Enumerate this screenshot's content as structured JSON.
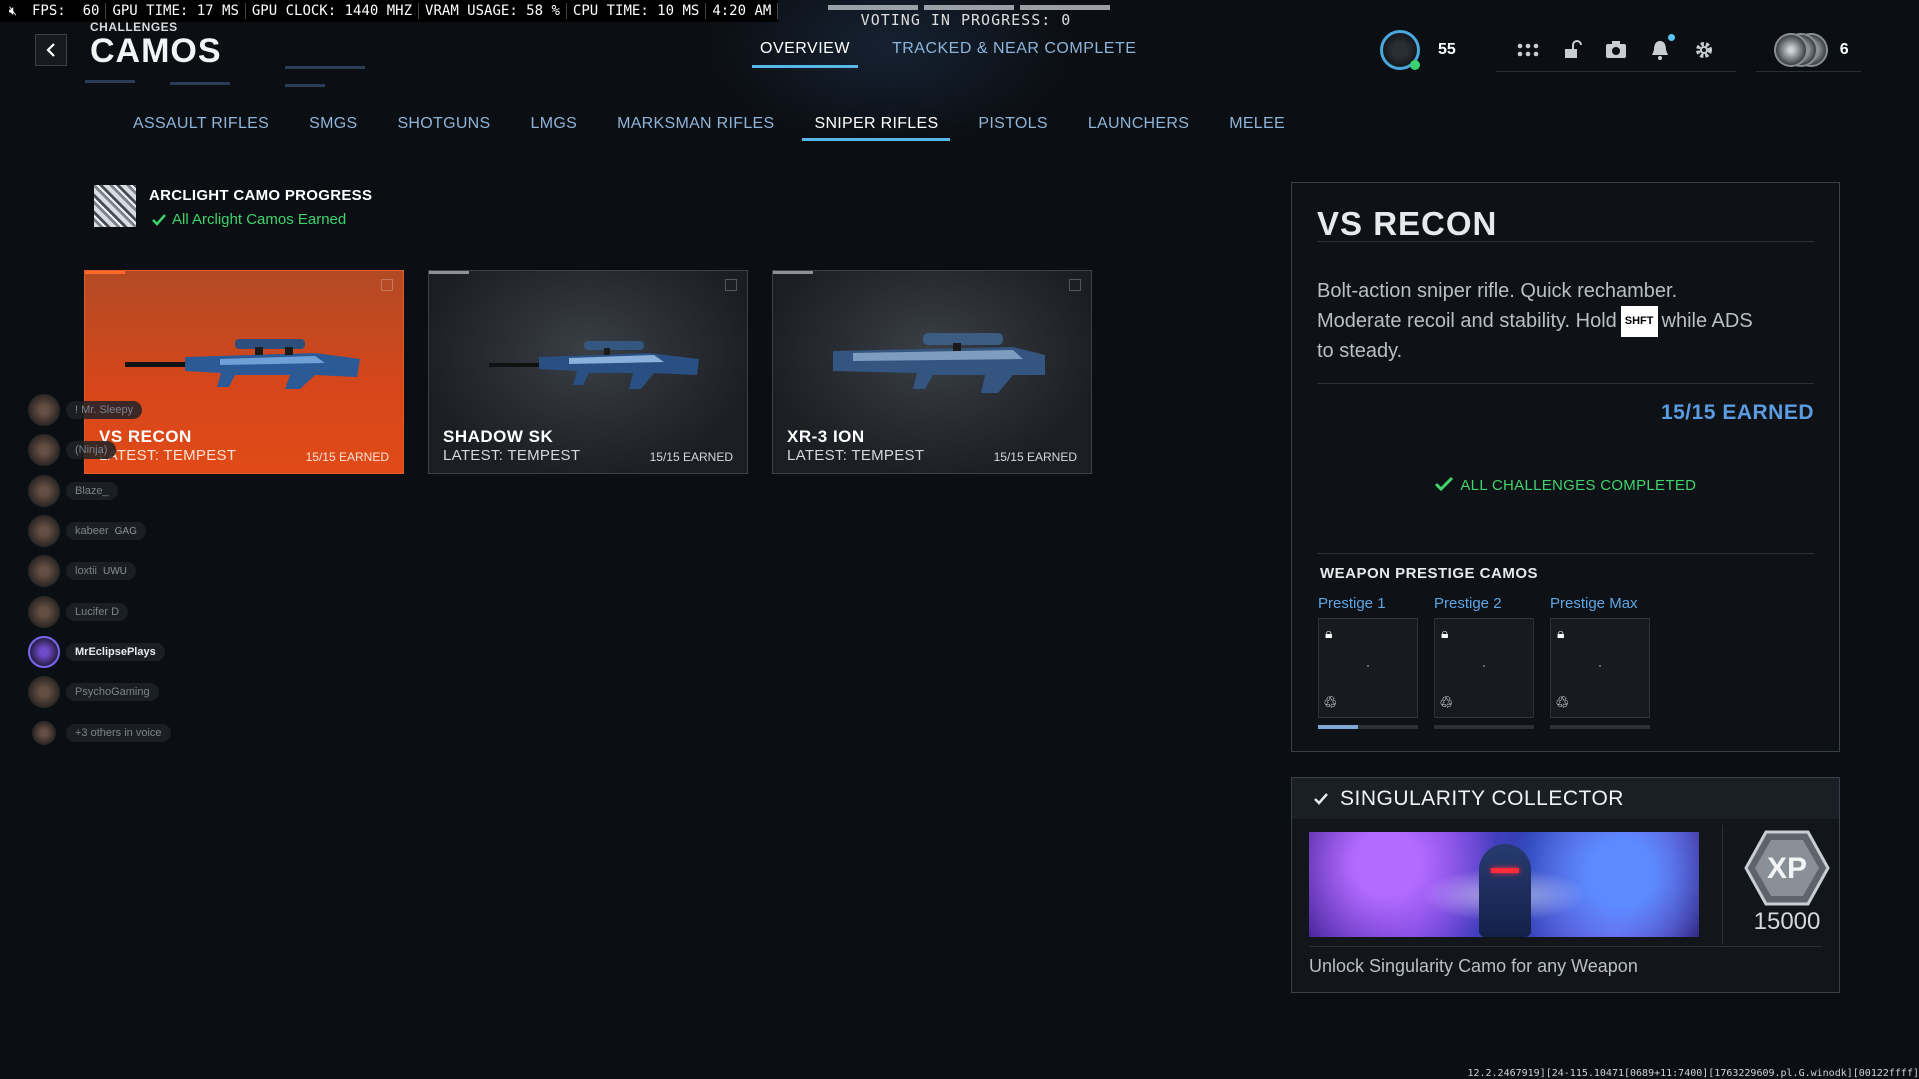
{
  "perf": {
    "mute_icon": "speaker-muted-icon",
    "fps": "FPS:  60",
    "gpu_time": "GPU TIME: 17 MS",
    "gpu_clock": "GPU CLOCK: 1440 MHZ",
    "vram": "VRAM USAGE: 58 %",
    "cpu_time": "CPU TIME: 10 MS",
    "clock": "4:20 AM"
  },
  "voting": {
    "text": "VOTING IN PROGRESS: 0"
  },
  "header": {
    "breadcrumb": "CHALLENGES",
    "title": "CAMOS",
    "tabs": [
      {
        "label": "OVERVIEW",
        "active": true
      },
      {
        "label": "TRACKED & NEAR COMPLETE",
        "active": false
      }
    ],
    "rank": "55",
    "squad_count": "6",
    "icons": [
      "apps-grid-icon",
      "unlock-icon",
      "camera-icon",
      "bell-icon",
      "gear-icon"
    ]
  },
  "categories": [
    {
      "label": "ASSAULT RIFLES"
    },
    {
      "label": "SMGS"
    },
    {
      "label": "SHOTGUNS"
    },
    {
      "label": "LMGS"
    },
    {
      "label": "MARKSMAN RIFLES"
    },
    {
      "label": "SNIPER RIFLES",
      "active": true
    },
    {
      "label": "PISTOLS"
    },
    {
      "label": "LAUNCHERS"
    },
    {
      "label": "MELEE"
    }
  ],
  "arclight": {
    "title": "ARCLIGHT CAMO PROGRESS",
    "status": "All Arclight Camos Earned"
  },
  "weapons": [
    {
      "name": "VS RECON",
      "latest": "LATEST: TEMPEST",
      "earned": "15/15 EARNED",
      "selected": true
    },
    {
      "name": "SHADOW SK",
      "latest": "LATEST: TEMPEST",
      "earned": "15/15 EARNED"
    },
    {
      "name": "XR-3 ION",
      "latest": "LATEST: TEMPEST",
      "earned": "15/15 EARNED"
    }
  ],
  "party": [
    {
      "name": "! Mr. Sleepy"
    },
    {
      "name": "(Ninja)"
    },
    {
      "name": "Blaze_"
    },
    {
      "name": "kabeer",
      "tag": "GAG"
    },
    {
      "name": "loxtii",
      "tag": "UWU"
    },
    {
      "name": "Lucifer D"
    },
    {
      "name": "MrEclipsePlays",
      "me": true
    },
    {
      "name": "PsychoGaming"
    },
    {
      "name": "+3 others in voice"
    }
  ],
  "detail": {
    "title": "VS RECON",
    "desc_line1": "Bolt-action sniper rifle.  Quick rechamber.",
    "desc_line2a": "Moderate recoil and stability.  Hold",
    "key": "SHFT",
    "desc_line2b": "while ADS",
    "desc_line3": "to steady.",
    "earned": "15/15 EARNED",
    "completed": "ALL CHALLENGES COMPLETED",
    "prestige_title": "WEAPON PRESTIGE CAMOS",
    "prestige": [
      {
        "label": "Prestige 1",
        "progress": 0.4
      },
      {
        "label": "Prestige 2",
        "progress": 0
      },
      {
        "label": "Prestige Max",
        "progress": 0
      }
    ]
  },
  "singularity": {
    "title": "SINGULARITY COLLECTOR",
    "xp": "15000",
    "xp_badge": "XP",
    "desc": "Unlock Singularity Camo for any Weapon"
  },
  "build": "12.2.2467919][24-115.10471[0689+11:7400][1763229609.pl.G.winodk][00122ffff]"
}
